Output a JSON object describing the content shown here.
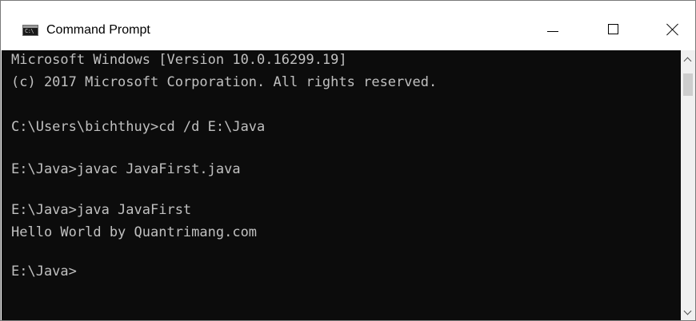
{
  "window": {
    "title": "Command Prompt",
    "app_icon": {
      "name": "command-prompt-icon",
      "text": "C:\\"
    },
    "controls": {
      "minimize_icon": "minimize-icon",
      "maximize_icon": "maximize-icon",
      "close_icon": "close-icon"
    }
  },
  "console": {
    "background": "#0c0c0c",
    "foreground": "#c0c0c0",
    "lines": [
      "Microsoft Windows [Version 10.0.16299.19]",
      "(c) 2017 Microsoft Corporation. All rights reserved.",
      "",
      "C:\\Users\\bichthuy>cd /d E:\\Java",
      "",
      "E:\\Java>javac JavaFirst.java",
      "",
      "E:\\Java>java JavaFirst",
      "Hello World by Quantrimang.com",
      "",
      "E:\\Java>"
    ]
  },
  "scrollbar": {
    "up_icon": "scroll-up-arrow-icon",
    "down_icon": "scroll-down-arrow-icon"
  }
}
